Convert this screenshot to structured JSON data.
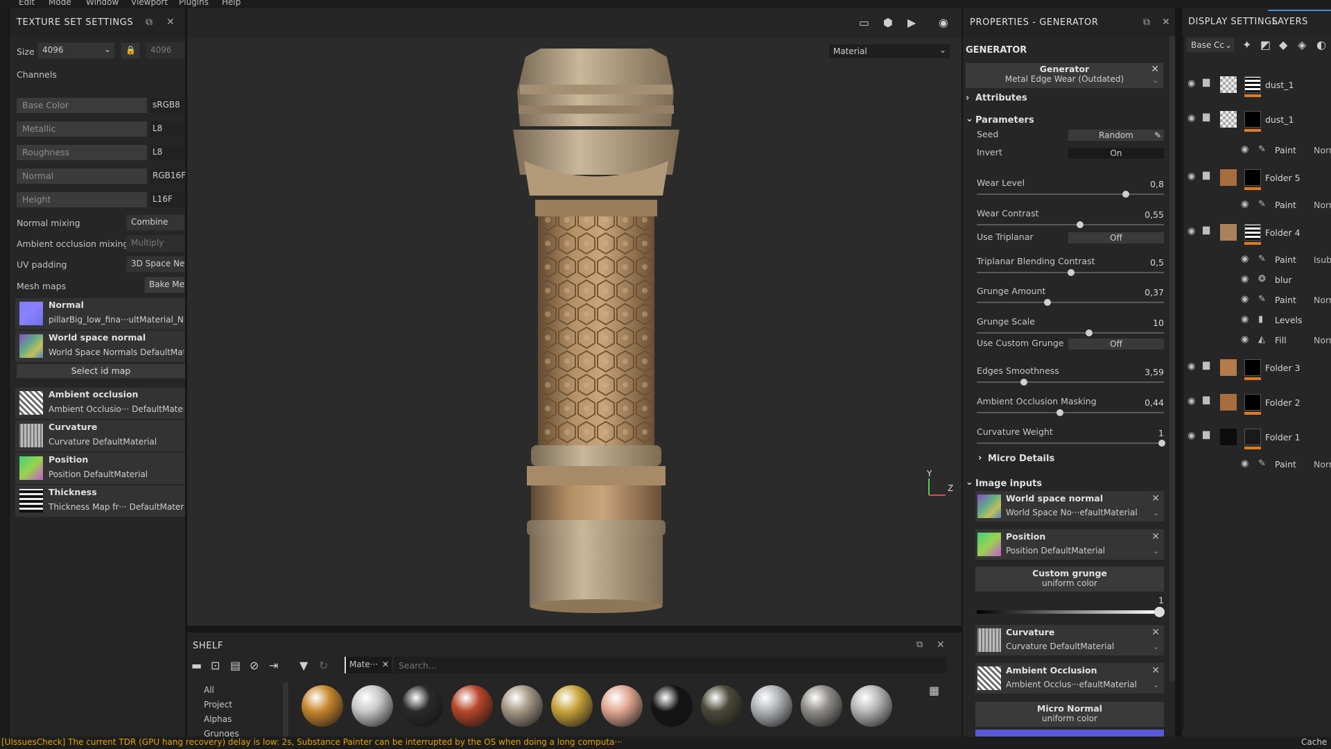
{
  "menu": [
    "Edit",
    "Mode",
    "Window",
    "Viewport",
    "Plugins",
    "Help"
  ],
  "texture_set": {
    "title": "TEXTURE SET SETTINGS",
    "size_label": "Size",
    "size_value": "4096",
    "size_value2": "4096",
    "channels_label": "Channels",
    "channels": [
      {
        "name": "Base Color",
        "format": "sRGB8"
      },
      {
        "name": "Metallic",
        "format": "L8"
      },
      {
        "name": "Roughness",
        "format": "L8"
      },
      {
        "name": "Normal",
        "format": "RGB16F"
      },
      {
        "name": "Height",
        "format": "L16F"
      }
    ],
    "normal_mixing_label": "Normal mixing",
    "normal_mixing_value": "Combine",
    "ao_mixing_label": "Ambient occlusion mixing",
    "ao_mixing_value": "Multiply",
    "uv_padding_label": "UV padding",
    "uv_padding_value": "3D Space Ne",
    "mesh_maps_label": "Mesh maps",
    "bake_label": "Bake Me",
    "mesh_maps": [
      {
        "title": "Normal",
        "sub": "pillarBig_low_fina···ultMaterial_Nc",
        "thumb": "normal"
      },
      {
        "title": "World space normal",
        "sub": "World Space Normals DefaultMat",
        "thumb": "wsn"
      },
      {
        "title": "Ambient occlusion",
        "sub": "Ambient Occlusio··· DefaultMater",
        "thumb": "ao"
      },
      {
        "title": "Curvature",
        "sub": "Curvature DefaultMaterial",
        "thumb": "curv"
      },
      {
        "title": "Position",
        "sub": "Position DefaultMaterial",
        "thumb": "pos"
      },
      {
        "title": "Thickness",
        "sub": "Thickness Map fr··· DefaultMater",
        "thumb": "thick"
      }
    ],
    "select_id_map": "Select id map"
  },
  "viewport": {
    "mode_select": "Material",
    "axis_y": "Y",
    "axis_z": "Z"
  },
  "shelf": {
    "title": "SHELF",
    "filter_tag": "Mate···",
    "search_placeholder": "Search...",
    "categories": [
      "All",
      "Project",
      "Alphas",
      "Grunges"
    ],
    "materials": [
      {
        "color": "#c8872e"
      },
      {
        "color": "#c9c9c9"
      },
      {
        "color": "#2a2a2a"
      },
      {
        "color": "#b8462a"
      },
      {
        "color": "#a59885"
      },
      {
        "color": "#c9a43a"
      },
      {
        "color": "#e2a892"
      },
      {
        "color": "#151515"
      },
      {
        "color": "#4b4a3a"
      },
      {
        "color": "#b0b3b8"
      },
      {
        "color": "#8f8d88"
      },
      {
        "color": "#b8b8b8"
      }
    ]
  },
  "properties": {
    "title": "PROPERTIES - GENERATOR",
    "section": "GENERATOR",
    "generator_label": "Generator",
    "generator_value": "Metal Edge Wear (Outdated)",
    "attributes": "Attributes",
    "parameters": "Parameters",
    "seed_label": "Seed",
    "seed_value": "Random",
    "invert_label": "Invert",
    "invert_value": "On",
    "sliders": [
      {
        "label": "Wear Level",
        "value": "0,8",
        "pos": 0.8
      },
      {
        "label": "Wear Contrast",
        "value": "0,55",
        "pos": 0.55
      },
      {
        "label": "Triplanar Blending Contrast",
        "value": "0,5",
        "pos": 0.5
      },
      {
        "label": "Grunge Amount",
        "value": "0,37",
        "pos": 0.37
      },
      {
        "label": "Grunge Scale",
        "value": "10",
        "pos": 0.6
      },
      {
        "label": "Edges Smoothness",
        "value": "3,59",
        "pos": 0.24
      },
      {
        "label": "Ambient Occlusion Masking",
        "value": "0,44",
        "pos": 0.44
      },
      {
        "label": "Curvature Weight",
        "value": "1",
        "pos": 1.0
      }
    ],
    "use_triplanar_label": "Use Triplanar",
    "use_triplanar_value": "Off",
    "use_custom_grunge_label": "Use Custom Grunge",
    "use_custom_grunge_value": "Off",
    "micro_details": "Micro Details",
    "image_inputs": "Image inputs",
    "inputs": [
      {
        "title": "World space normal",
        "sub": "World Space No···efaultMaterial",
        "thumb": "wsn"
      },
      {
        "title": "Position",
        "sub": "Position DefaultMaterial",
        "thumb": "pos"
      }
    ],
    "custom_grunge": {
      "title": "Custom grunge",
      "sub": "uniform color",
      "value": "1"
    },
    "inputs2": [
      {
        "title": "Curvature",
        "sub": "Curvature DefaultMaterial",
        "thumb": "curv"
      },
      {
        "title": "Ambient Occlusion",
        "sub": "Ambient Occlus···efaultMaterial",
        "thumb": "ao"
      }
    ],
    "micro_normal": {
      "title": "Micro Normal",
      "sub": "uniform color"
    }
  },
  "layers": {
    "tab_display": "DISPLAY SETTINGS",
    "tab_layers": "LAYERS",
    "channel_select": "Base Cc",
    "items": [
      {
        "name": "dust_1",
        "kind": "layer",
        "thumb": "checker",
        "mask": "white"
      },
      {
        "name": "dust_1",
        "kind": "layer",
        "thumb": "checker",
        "mask": "black"
      },
      {
        "name": "Paint",
        "kind": "sub",
        "blend": "Norm",
        "icon": "brush"
      },
      {
        "name": "Folder 5",
        "kind": "folder",
        "thumb": "#a86d3d",
        "mask": "black"
      },
      {
        "name": "Paint",
        "kind": "sub",
        "blend": "Norm",
        "icon": "brush"
      },
      {
        "name": "Folder 4",
        "kind": "folder",
        "thumb": "#a9825d",
        "mask": "white"
      },
      {
        "name": "Paint",
        "kind": "sub",
        "blend": "Isub",
        "icon": "brush"
      },
      {
        "name": "blur",
        "kind": "sub",
        "blend": "",
        "icon": "blur"
      },
      {
        "name": "Paint",
        "kind": "sub",
        "blend": "Norm",
        "icon": "brush"
      },
      {
        "name": "Levels",
        "kind": "sub",
        "blend": "",
        "icon": "levels"
      },
      {
        "name": "Fill",
        "kind": "sub",
        "blend": "Norm",
        "icon": "fill"
      },
      {
        "name": "Folder 3",
        "kind": "folder",
        "thumb": "#b57b4a",
        "mask": "black"
      },
      {
        "name": "Folder 2",
        "kind": "folder",
        "thumb": "#a86d3d",
        "mask": "black"
      },
      {
        "name": "Folder 1",
        "kind": "folder",
        "thumb": "#0c0c0c",
        "mask": "dark"
      },
      {
        "name": "Paint",
        "kind": "sub",
        "blend": "Norm",
        "icon": "brush"
      }
    ]
  },
  "status": {
    "message": "[UIssuesCheck] The current TDR (GPU hang recovery) delay is low: 2s, Substance Painter can be interrupted by the OS when doing a long computa···",
    "right": "Cache"
  }
}
